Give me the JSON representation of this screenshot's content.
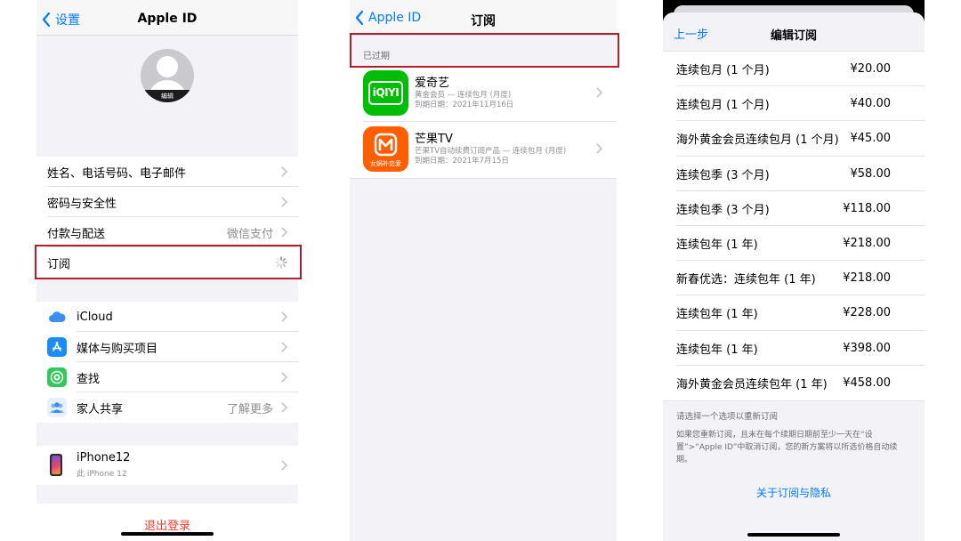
{
  "settings": {
    "back_label": "设置",
    "title": "Apple ID",
    "avatar_edit": "编辑",
    "account_rows": [
      {
        "label": "姓名、电话号码、电子邮件",
        "value": ""
      },
      {
        "label": "密码与安全性",
        "value": ""
      },
      {
        "label": "付款与配送",
        "value": "微信支付"
      },
      {
        "label": "订阅",
        "value": ""
      }
    ],
    "service_rows": [
      {
        "label": "iCloud",
        "value": "",
        "icon": "icloud-icon"
      },
      {
        "label": "媒体与购买项目",
        "value": "",
        "icon": "app-store-icon"
      },
      {
        "label": "查找",
        "value": "",
        "icon": "find-my-icon"
      },
      {
        "label": "家人共享",
        "value": "了解更多",
        "icon": "family-sharing-icon"
      }
    ],
    "device": {
      "name": "iPhone12",
      "subtitle": "此 iPhone 12"
    },
    "sign_out": "退出登录"
  },
  "subscriptions": {
    "back_label": "Apple ID",
    "title": "订阅",
    "section_header": "已过期",
    "items": [
      {
        "name": "爱奇艺",
        "line2": "黄金会员 — 连续包月 (月度)",
        "line3": "到期日期：2021年11月16日",
        "icon_text": "iQIYI"
      },
      {
        "name": "芒果TV",
        "line2": "芒果TV自动续费订阅产品 — 连续包月 (月度)",
        "line3": "到期日期：2021年7月15日",
        "icon_text": "女娲补恋爱"
      }
    ]
  },
  "edit": {
    "back_label": "上一步",
    "title": "编辑订阅",
    "plans": [
      {
        "name": "连续包月 (1 个月)",
        "price": "¥20.00"
      },
      {
        "name": "连续包月 (1 个月)",
        "price": "¥40.00"
      },
      {
        "name": "海外黄金会员连续包月 (1 个月)",
        "price": "¥45.00"
      },
      {
        "name": "连续包季 (3 个月)",
        "price": "¥58.00"
      },
      {
        "name": "连续包季 (3 个月)",
        "price": "¥118.00"
      },
      {
        "name": "连续包年 (1 年)",
        "price": "¥218.00"
      },
      {
        "name": "新春优选：连续包年 (1 年)",
        "price": "¥218.00"
      },
      {
        "name": "连续包年 (1 年)",
        "price": "¥228.00"
      },
      {
        "name": "连续包年 (1 年)",
        "price": "¥398.00"
      },
      {
        "name": "海外黄金会员连续包年 (1 年)",
        "price": "¥458.00"
      }
    ],
    "hint": "请选择一个选项以重新订阅",
    "note": "如果您重新订阅，且未在每个续期日期前至少一天在“设置”>“Apple ID”中取消订阅，您的新方案将以所选价格自动续期。",
    "privacy_link": "关于订阅与隐私"
  },
  "colors": {
    "accent": "#007aff",
    "highlight": "#b01e2e",
    "destructive": "#ff3b30",
    "iqiyi": "#00be06",
    "mango": "#ff5f00"
  }
}
